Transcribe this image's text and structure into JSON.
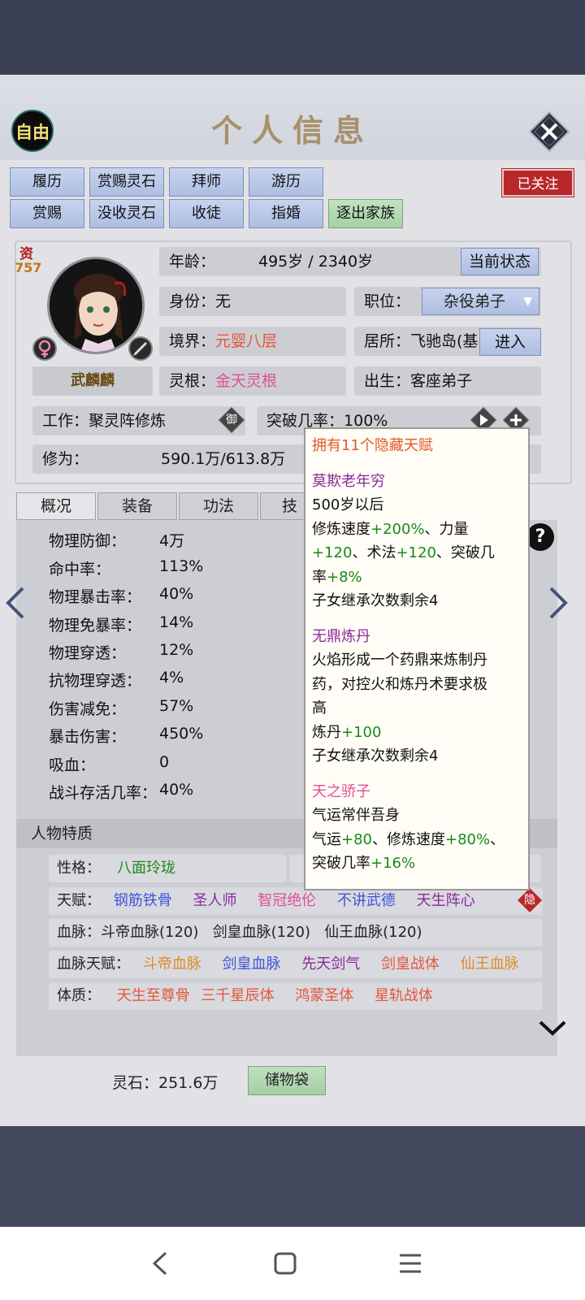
{
  "header": {
    "title": "个人信息",
    "free_label": "自由",
    "follow_label": "已关注"
  },
  "actions": {
    "row1": [
      "履历",
      "赏赐灵石",
      "拜师",
      "游历"
    ],
    "row2": [
      "赏赐",
      "没收灵石",
      "收徒",
      "指婚",
      "逐出家族"
    ]
  },
  "profile": {
    "aptitude_label": "资",
    "aptitude_value": "757",
    "name": "武麟麟",
    "age_label": "年龄：",
    "age_value": "495岁 / 2340岁",
    "current_state_btn": "当前状态",
    "identity_label": "身份：",
    "identity_value": "无",
    "position_label": "职位：",
    "position_value": "杂役弟子",
    "realm_label": "境界：",
    "realm_value": "元婴八层",
    "residence_label": "居所：",
    "residence_value": "飞驰岛(基",
    "enter_btn": "进入",
    "root_label": "灵根：",
    "root_value": "金天灵根",
    "birth_label": "出生：",
    "birth_value": "客座弟子",
    "work_label": "工作：",
    "work_value": "聚灵阵修炼",
    "work_badge": "御",
    "breakthrough_label": "突破几率：",
    "breakthrough_value": "100%",
    "cultivation_label": "修为：",
    "cultivation_value": "590.1万/613.8万"
  },
  "tabs": [
    "概况",
    "装备",
    "功法",
    "技"
  ],
  "stats": [
    {
      "label": "物理防御：",
      "value": "4万"
    },
    {
      "label": "命中率：",
      "value": "113%"
    },
    {
      "label": "物理暴击率：",
      "value": "40%"
    },
    {
      "label": "物理免暴率：",
      "value": "14%"
    },
    {
      "label": "物理穿透：",
      "value": "12%"
    },
    {
      "label": "抗物理穿透：",
      "value": "4%"
    },
    {
      "label": "伤害减免：",
      "value": "57%"
    },
    {
      "label": "暴击伤害：",
      "value": "450%"
    },
    {
      "label": "吸血：",
      "value": "0"
    },
    {
      "label": "战斗存活几率：",
      "value": "40%"
    }
  ],
  "traits": {
    "header": "人物特质",
    "personality_label": "性格：",
    "personality_value": "八面玲珑",
    "talent_label": "天赋：",
    "talents": [
      "钢筋铁骨",
      "圣人师",
      "智冠绝伦",
      "不讲武德",
      "天生阵心"
    ],
    "hidden_badge": "隐",
    "bloodline_label": "血脉：",
    "bloodlines": "斗帝血脉(120)   剑皇血脉(120)   仙王血脉(120)",
    "bloodline_talent_label": "血脉天赋：",
    "bloodline_talents": [
      "斗帝血脉",
      "剑皇血脉",
      "先天剑气",
      "剑皇战体",
      "仙王血脉"
    ],
    "physique_label": "体质：",
    "physiques": [
      "天生至尊骨",
      "三千星辰体",
      "鸿蒙圣体",
      "星轨战体"
    ]
  },
  "tooltip": {
    "title": "拥有11个隐藏天赋",
    "t1_name": "莫欺老年穷",
    "t1_l1": "500岁以后",
    "t1_l2a": "修炼速度",
    "t1_l2b": "+200%",
    "t1_l2c": "、力量",
    "t1_l3a": "+120",
    "t1_l3b": "、术法",
    "t1_l3c": "+120",
    "t1_l3d": "、突破几",
    "t1_l4a": "率",
    "t1_l4b": "+8%",
    "t1_l5": "子女继承次数剩余4",
    "t2_name": "无鼎炼丹",
    "t2_l1": "火焰形成一个药鼎来炼制丹",
    "t2_l2": "药，对控火和炼丹术要求极",
    "t2_l3": "高",
    "t2_l4a": "炼丹",
    "t2_l4b": "+100",
    "t2_l5": "子女继承次数剩余4",
    "t3_name": "天之骄子",
    "t3_l1": "气运常伴吾身",
    "t3_l2a": "气运",
    "t3_l2b": "+80",
    "t3_l2c": "、修炼速度",
    "t3_l2d": "+80%",
    "t3_l2e": "、",
    "t3_l3a": "突破几率",
    "t3_l3b": "+16%"
  },
  "footer": {
    "stones_label": "灵石：",
    "stones_value": "251.6万",
    "bag_label": "储物袋"
  },
  "colors": {
    "follow": "#b8282a",
    "realm": "#e3573a",
    "root": "#e04f97",
    "positive": "#1a8a1a"
  }
}
